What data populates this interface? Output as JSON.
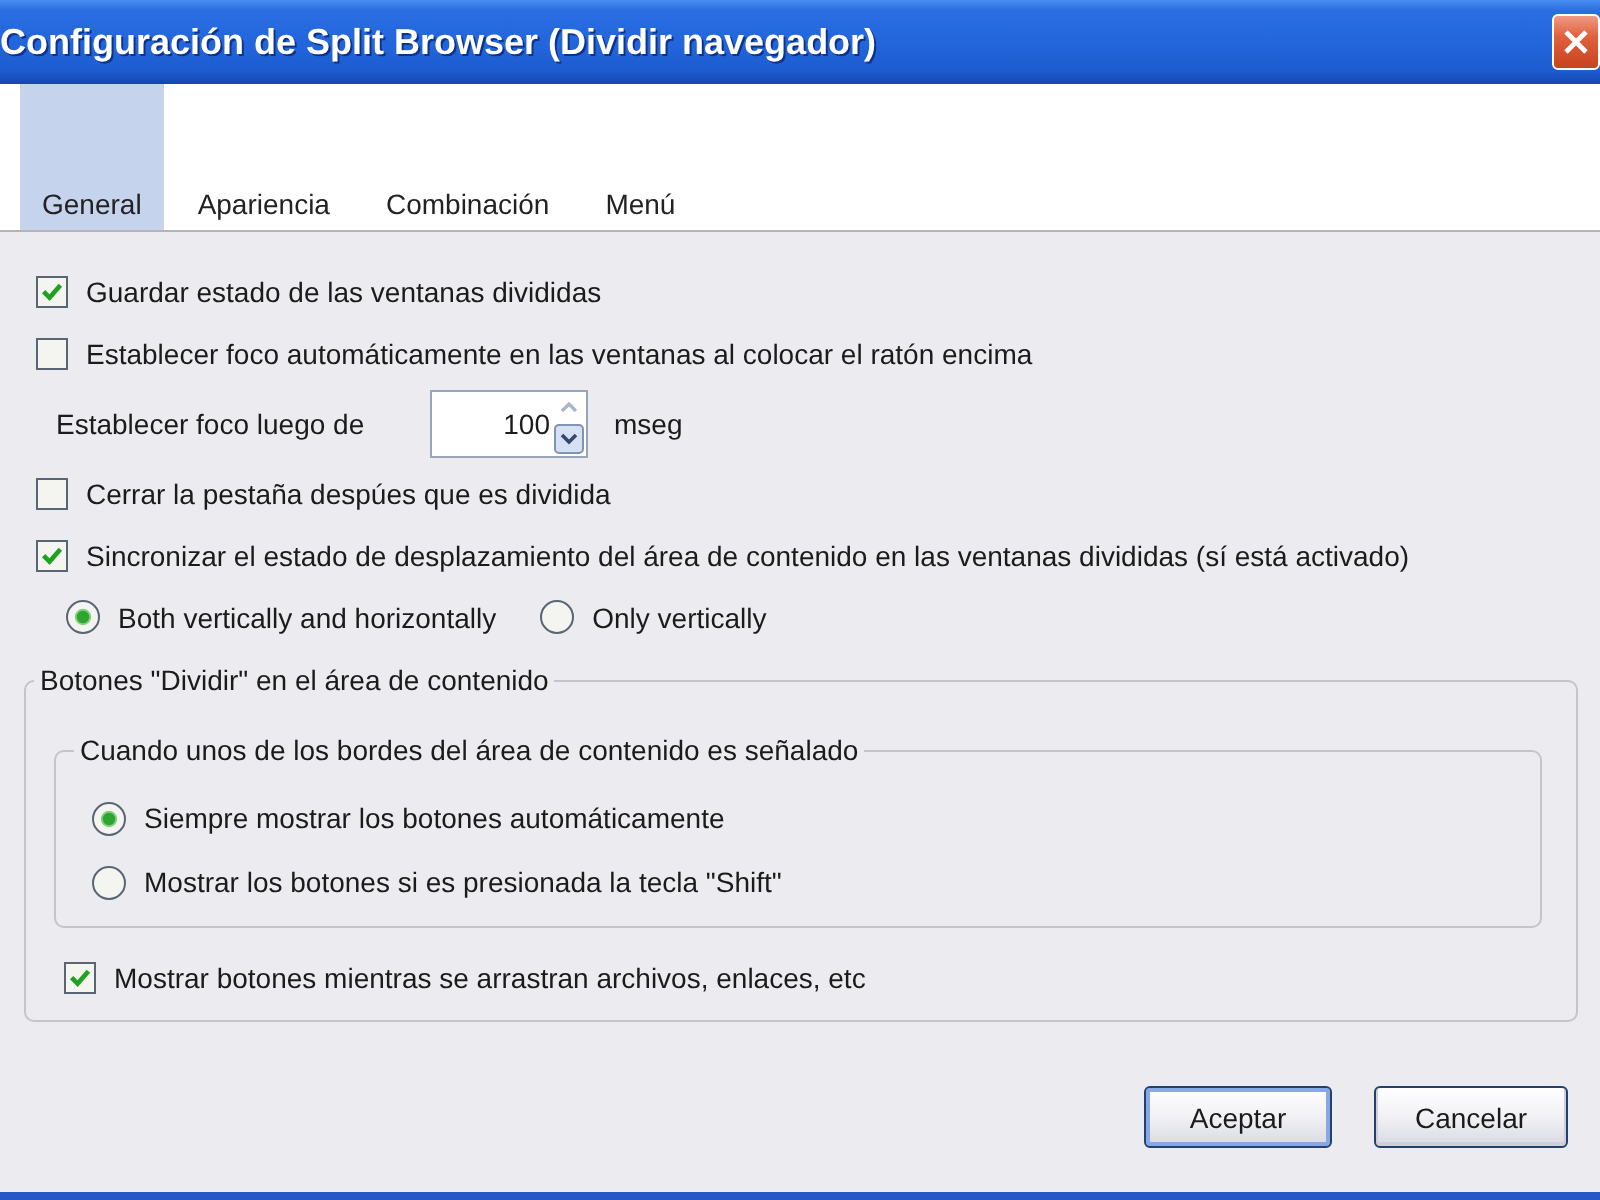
{
  "window": {
    "title": "Configuración de Split Browser (Dividir navegador)"
  },
  "tabs": [
    {
      "label": "General",
      "selected": true
    },
    {
      "label": "Apariencia",
      "selected": false
    },
    {
      "label": "Combinación",
      "selected": false
    },
    {
      "label": "Menú",
      "selected": false
    }
  ],
  "options": [
    {
      "kind": "checkbox",
      "label": "Guardar estado de las ventanas divididas",
      "checked": true
    },
    {
      "kind": "checkbox",
      "label": "Establecer foco automáticamente en las ventanas al colocar el ratón encima",
      "checked": false
    },
    {
      "kind": "spinner",
      "label": "Establecer foco luego de",
      "value": "100",
      "unit": "mseg"
    },
    {
      "kind": "checkbox",
      "label": "Cerrar la pestaña despúes que es dividida",
      "checked": false
    },
    {
      "kind": "checkbox",
      "label": "Sincronizar el estado de desplazamiento del área de contenido en las ventanas divididas (sí está activado)",
      "checked": true
    },
    {
      "kind": "radios",
      "choices": [
        {
          "label": "Both vertically and horizontally",
          "selected": true
        },
        {
          "label": "Only vertically",
          "selected": false
        }
      ]
    }
  ],
  "split_buttons": {
    "title": "Botones \"Dividir\" en el área de contenido",
    "hover_group": {
      "title": "Cuando unos de los bordes del área de contenido es señalado",
      "choices": [
        {
          "label": "Siempre mostrar los botones automáticamente",
          "selected": true
        },
        {
          "label": "Mostrar los botones si es presionada la tecla \"Shift\"",
          "selected": false
        }
      ]
    },
    "drag_option": {
      "label": "Mostrar botones mientras se arrastran archivos, enlaces, etc",
      "checked": true
    }
  },
  "buttons": [
    {
      "label": "Aceptar",
      "default": true
    },
    {
      "label": "Cancelar",
      "default": false
    }
  ]
}
